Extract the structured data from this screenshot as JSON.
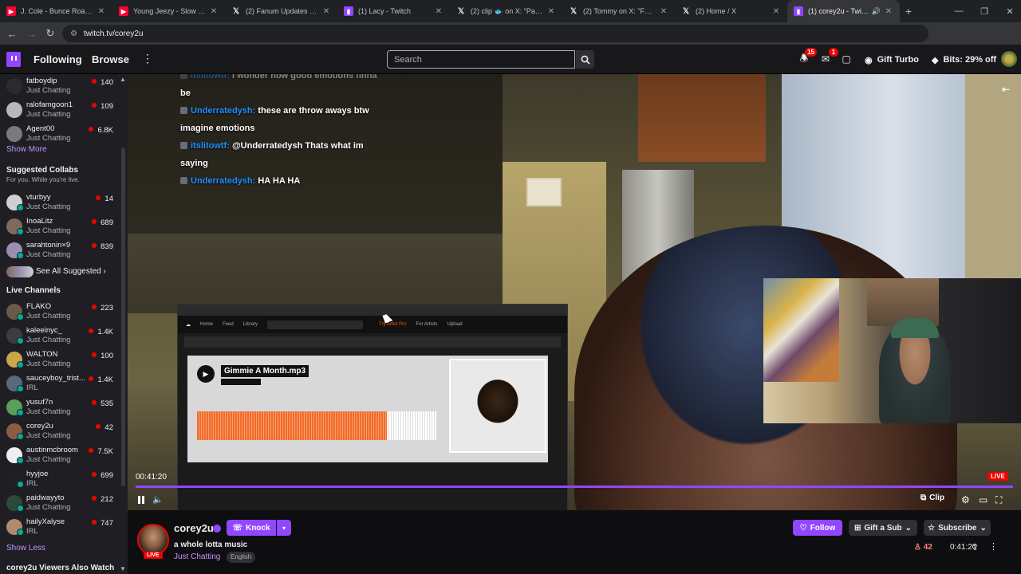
{
  "browser": {
    "tabs": [
      {
        "title": "J. Cole - Bunce Road Blues",
        "favicon": "youtube-icon",
        "active": false
      },
      {
        "title": "Young Jeezy - Slow Grind",
        "favicon": "youtube-icon",
        "active": false
      },
      {
        "title": "(2) Fanum Updates 🖊 on",
        "favicon": "x-icon",
        "active": false
      },
      {
        "title": "(1) Lacy - Twitch",
        "favicon": "twitch-icon",
        "active": false
      },
      {
        "title": "(2) clip 🐟 on X: \"Paul Mi",
        "favicon": "x-icon",
        "active": false
      },
      {
        "title": "(2) Tommy on X: \"FunnyM",
        "favicon": "x-icon",
        "active": false
      },
      {
        "title": "(2) Home / X",
        "favicon": "x-icon",
        "active": false
      },
      {
        "title": "(1) corey2u - Twitch",
        "favicon": "twitch-icon",
        "active": true
      }
    ],
    "url": "twitch.tv/corey2u"
  },
  "topnav": {
    "following": "Following",
    "browse": "Browse",
    "search_placeholder": "Search",
    "notifications_count": "15",
    "inbox_count": "1",
    "gift_turbo": "Gift Turbo",
    "bits": "Bits: 29% off"
  },
  "sidebar": {
    "followed": [
      {
        "name": "fatboydip",
        "category": "Just Chatting",
        "viewers": "140",
        "avatar_color": "#2b2b2b"
      },
      {
        "name": "ralofamgoon1",
        "category": "Just Chatting",
        "viewers": "109",
        "avatar_color": "#b8b8b8"
      },
      {
        "name": "Agent00",
        "category": "Just Chatting",
        "viewers": "6.8K",
        "avatar_color": "#7a7a7a"
      }
    ],
    "show_more": "Show More",
    "suggested_title": "Suggested Collabs",
    "suggested_sub": "For you. While you're live.",
    "suggested": [
      {
        "name": "vturbyy",
        "category": "Just Chatting",
        "viewers": "14",
        "avatar_color": "#d0d0d0"
      },
      {
        "name": "InoaLitz",
        "category": "Just Chatting",
        "viewers": "689",
        "avatar_color": "#7f6a5d"
      },
      {
        "name": "sarahtonin×9",
        "category": "Just Chatting",
        "viewers": "839",
        "avatar_color": "#9a8fb0"
      }
    ],
    "see_all_suggested": "See All Suggested",
    "live_title": "Live Channels",
    "live": [
      {
        "name": "FLAKO",
        "category": "Just Chatting",
        "viewers": "223",
        "avatar_color": "#6a5a4a"
      },
      {
        "name": "kaleeinyc_",
        "category": "Just Chatting",
        "viewers": "1.4K",
        "avatar_color": "#3d3d3d"
      },
      {
        "name": "WALTON",
        "category": "Just Chatting",
        "viewers": "100",
        "avatar_color": "#c9a84a"
      },
      {
        "name": "sauceyboy_trist...",
        "category": "IRL",
        "viewers": "1.4K",
        "avatar_color": "#5a6a7a"
      },
      {
        "name": "yusuf7n",
        "category": "Just Chatting",
        "viewers": "535",
        "avatar_color": "#5aa05a"
      },
      {
        "name": "corey2u",
        "category": "Just Chatting",
        "viewers": "42",
        "avatar_color": "#8a5e45"
      },
      {
        "name": "austinmcbroom",
        "category": "Just Chatting",
        "viewers": "7.5K",
        "avatar_color": "#efefef"
      },
      {
        "name": "hyyjoe",
        "category": "IRL",
        "viewers": "699",
        "avatar_color": "#202020"
      },
      {
        "name": "paidwayyto",
        "category": "Just Chatting",
        "viewers": "212",
        "avatar_color": "#2c4a3a"
      },
      {
        "name": "hailyXalyse",
        "category": "IRL",
        "viewers": "747",
        "avatar_color": "#b08a70"
      }
    ],
    "show_less": "Show Less",
    "also_watch": "corey2u Viewers Also Watch"
  },
  "stream": {
    "chat_overlay": [
      {
        "badge": true,
        "user": "itslitowtf:",
        "msg": "I wonder how good emotions finna",
        "faded": true
      },
      {
        "badge": false,
        "user": "",
        "msg": "be"
      },
      {
        "badge": true,
        "user": "Underratedysh:",
        "msg": "these are throw aways btw"
      },
      {
        "badge": false,
        "user": "",
        "msg": "imagine emotions"
      },
      {
        "badge": true,
        "user": "itslitowtf:",
        "msg": "@Underratedysh Thats what im"
      },
      {
        "badge": false,
        "user": "",
        "msg": "saying"
      },
      {
        "badge": true,
        "user": "Underratedysh:",
        "msg": "HA HA HA"
      }
    ],
    "track_title": "Gimmie A Month.mp3",
    "soundcloud_nav": [
      "Home",
      "Feed",
      "Library"
    ],
    "soundcloud_links": [
      "Try Artist Pro",
      "For Artists",
      "Upload"
    ],
    "elapsed": "00:41:20",
    "live_label": "LIVE",
    "clip_label": "Clip"
  },
  "channel": {
    "name": "corey2u",
    "knock": "Knock",
    "stream_title": "a whole lotta music",
    "category": "Just Chatting",
    "tag": "English",
    "live_label": "LIVE",
    "follow": "Follow",
    "gift_sub": "Gift a Sub",
    "subscribe": "Subscribe",
    "viewer_count": "42",
    "uptime": "0:41:20"
  },
  "colors": {
    "accent": "#9146ff",
    "live": "#eb0400",
    "link": "#bf94ff"
  }
}
